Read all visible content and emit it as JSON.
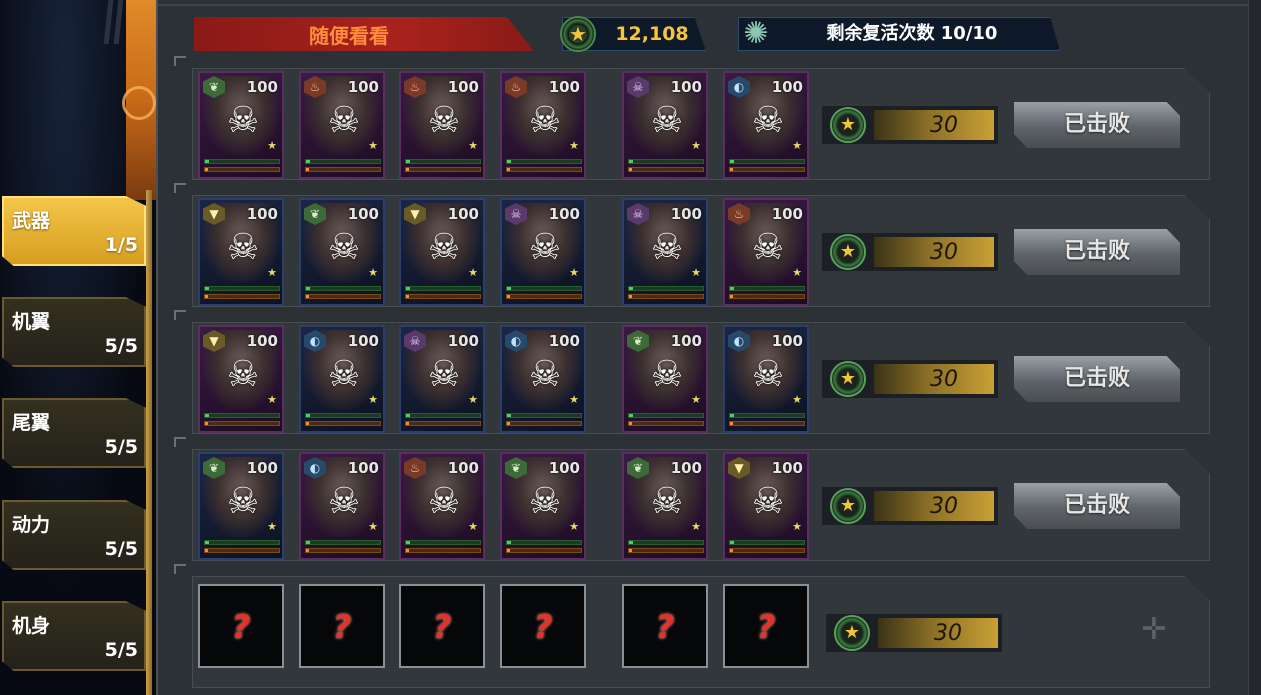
{
  "header": {
    "tab_title": "随便看看",
    "coin_value": "12,108",
    "coin_icon": "star-coin-icon",
    "revive_text": "剩余复活次数 10/10",
    "revive_icon": "revive-emblem-icon"
  },
  "sidebar": {
    "items": [
      {
        "label": "武器",
        "count": "1/5",
        "active": true
      },
      {
        "label": "机翼",
        "count": "5/5",
        "active": false
      },
      {
        "label": "尾翼",
        "count": "5/5",
        "active": false
      },
      {
        "label": "动力",
        "count": "5/5",
        "active": false
      },
      {
        "label": "机身",
        "count": "5/5",
        "active": false
      }
    ]
  },
  "rows": [
    {
      "units": [
        {
          "element": "leaf",
          "level": "100",
          "frame": "purple"
        },
        {
          "element": "fire",
          "level": "100",
          "frame": "purple"
        },
        {
          "element": "fire",
          "level": "100",
          "frame": "purple"
        },
        {
          "element": "fire",
          "level": "100",
          "frame": "purple"
        },
        {
          "element": "dark",
          "level": "100",
          "frame": "purple"
        },
        {
          "element": "water",
          "level": "100",
          "frame": "purple"
        }
      ],
      "reward": "30",
      "status_label": "已击败"
    },
    {
      "units": [
        {
          "element": "earth",
          "level": "100",
          "frame": "blue"
        },
        {
          "element": "leaf",
          "level": "100",
          "frame": "blue"
        },
        {
          "element": "earth",
          "level": "100",
          "frame": "blue"
        },
        {
          "element": "dark",
          "level": "100",
          "frame": "blue"
        },
        {
          "element": "dark",
          "level": "100",
          "frame": "blue"
        },
        {
          "element": "fire",
          "level": "100",
          "frame": "purple"
        }
      ],
      "reward": "30",
      "status_label": "已击败"
    },
    {
      "units": [
        {
          "element": "earth",
          "level": "100",
          "frame": "purple"
        },
        {
          "element": "water",
          "level": "100",
          "frame": "blue"
        },
        {
          "element": "dark",
          "level": "100",
          "frame": "blue"
        },
        {
          "element": "water",
          "level": "100",
          "frame": "blue"
        },
        {
          "element": "leaf",
          "level": "100",
          "frame": "purple"
        },
        {
          "element": "water",
          "level": "100",
          "frame": "blue"
        }
      ],
      "reward": "30",
      "status_label": "已击败"
    },
    {
      "units": [
        {
          "element": "leaf",
          "level": "100",
          "frame": "blue"
        },
        {
          "element": "water",
          "level": "100",
          "frame": "purple"
        },
        {
          "element": "fire",
          "level": "100",
          "frame": "purple"
        },
        {
          "element": "leaf",
          "level": "100",
          "frame": "purple"
        },
        {
          "element": "leaf",
          "level": "100",
          "frame": "purple"
        },
        {
          "element": "earth",
          "level": "100",
          "frame": "purple"
        }
      ],
      "reward": "30",
      "status_label": "已击败"
    },
    {
      "units": [
        {
          "unknown": "?"
        },
        {
          "unknown": "?"
        },
        {
          "unknown": "?"
        },
        {
          "unknown": "?"
        },
        {
          "unknown": "?"
        },
        {
          "unknown": "?"
        }
      ],
      "reward": "30",
      "status_label": ""
    }
  ],
  "icons": {
    "skull": "skull-icon",
    "star": "star-rank-icon",
    "plus": "plus-icon"
  },
  "colors": {
    "accent_red": "#a8221d",
    "gold": "#f7c53a",
    "active_tab": "#f3c64a"
  }
}
